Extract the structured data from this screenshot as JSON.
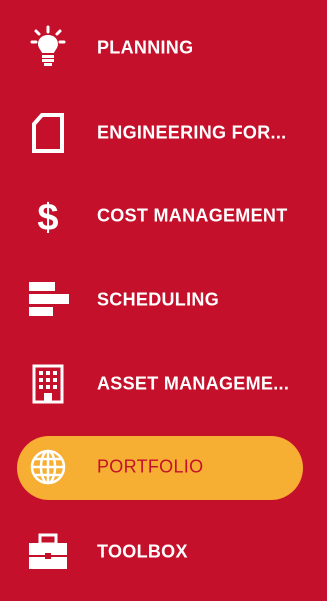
{
  "colors": {
    "background": "#c5102b",
    "active_pill": "#f6ae33",
    "text": "#ffffff",
    "active_text": "#c5102b"
  },
  "menu": {
    "items": [
      {
        "label": "PLANNING",
        "icon": "lightbulb-icon",
        "active": false
      },
      {
        "label": "ENGINEERING FOR...",
        "icon": "document-icon",
        "active": false
      },
      {
        "label": "COST MANAGEMENT",
        "icon": "dollar-icon",
        "active": false
      },
      {
        "label": "SCHEDULING",
        "icon": "schedule-bars-icon",
        "active": false
      },
      {
        "label": "ASSET MANAGEME...",
        "icon": "building-icon",
        "active": false
      },
      {
        "label": "PORTFOLIO",
        "icon": "globe-icon",
        "active": true
      },
      {
        "label": "TOOLBOX",
        "icon": "toolbox-icon",
        "active": false
      }
    ]
  }
}
